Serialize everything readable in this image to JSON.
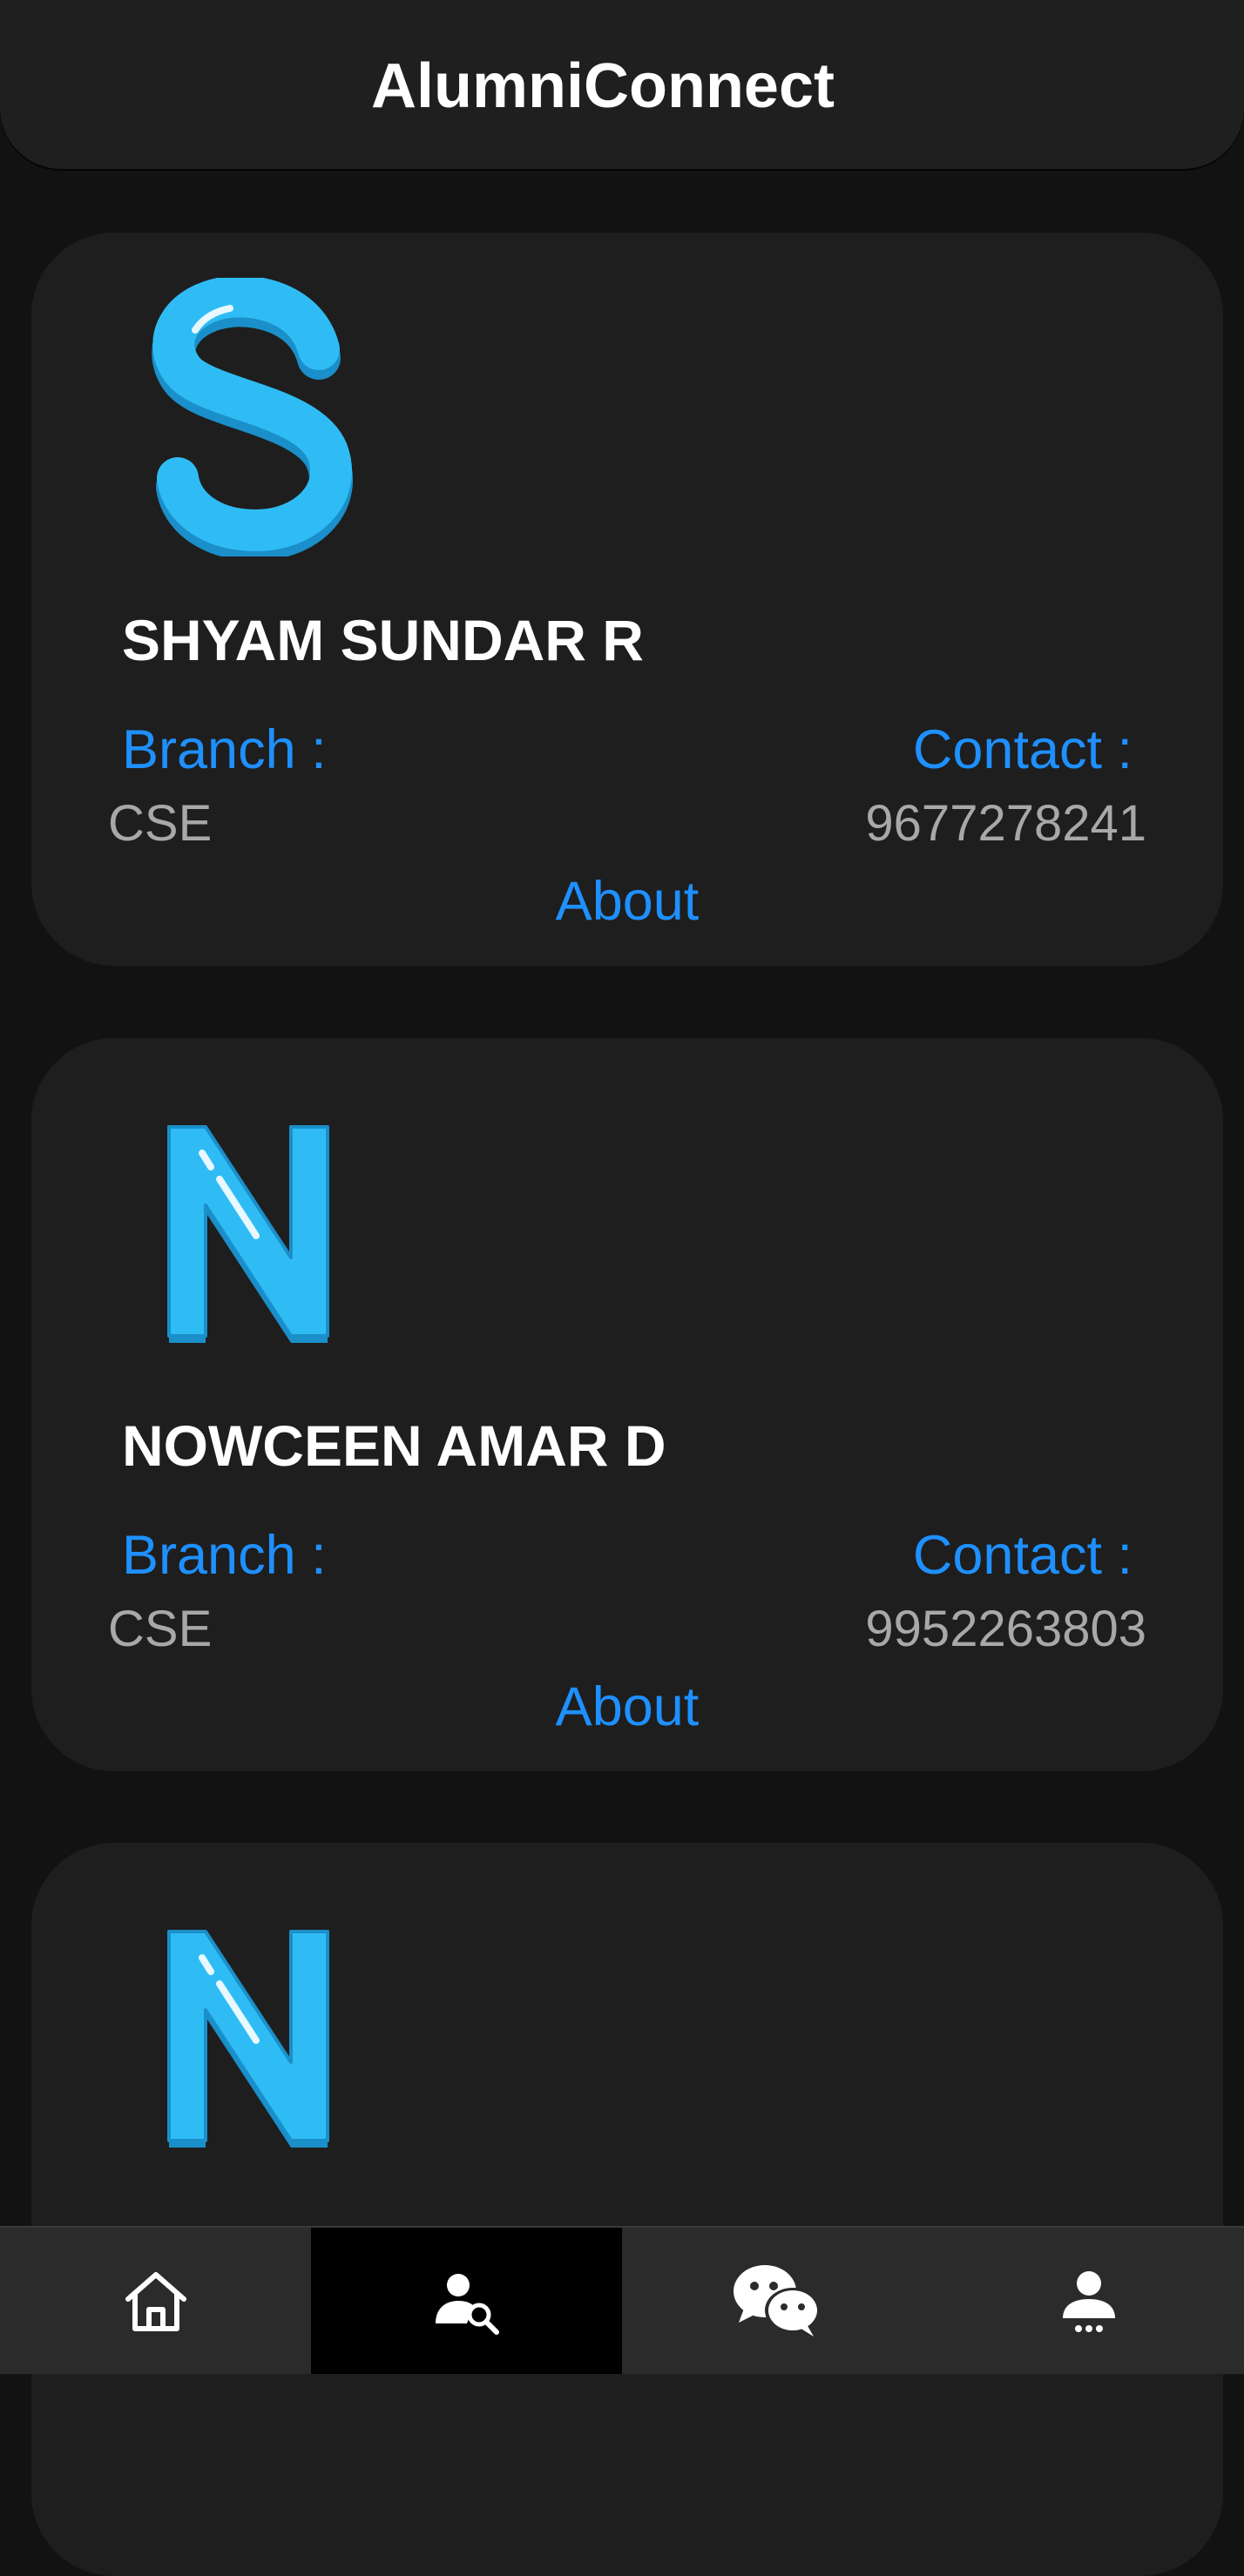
{
  "app": {
    "title": "AlumniConnect"
  },
  "cards": [
    {
      "initial": "S",
      "name": "SHYAM SUNDAR R",
      "branch_label": "Branch :",
      "branch": "CSE",
      "contact_label": "Contact :",
      "contact": "9677278241",
      "about": "About"
    },
    {
      "initial": "N",
      "name": "NOWCEEN AMAR D",
      "branch_label": "Branch :",
      "branch": "CSE",
      "contact_label": "Contact :",
      "contact": "9952263803",
      "about": "About"
    },
    {
      "initial": "N"
    }
  ],
  "nav": [
    {
      "icon": "home-icon",
      "active": false
    },
    {
      "icon": "user-search-icon",
      "active": true
    },
    {
      "icon": "chat-icon",
      "active": false
    },
    {
      "icon": "profile-icon",
      "active": false
    }
  ],
  "colors": {
    "background": "#121212",
    "card": "#1e1e1e",
    "accent": "#1e90ff",
    "avatar_letter": "#2fbcf5",
    "secondary_text": "#a8a8a8"
  }
}
